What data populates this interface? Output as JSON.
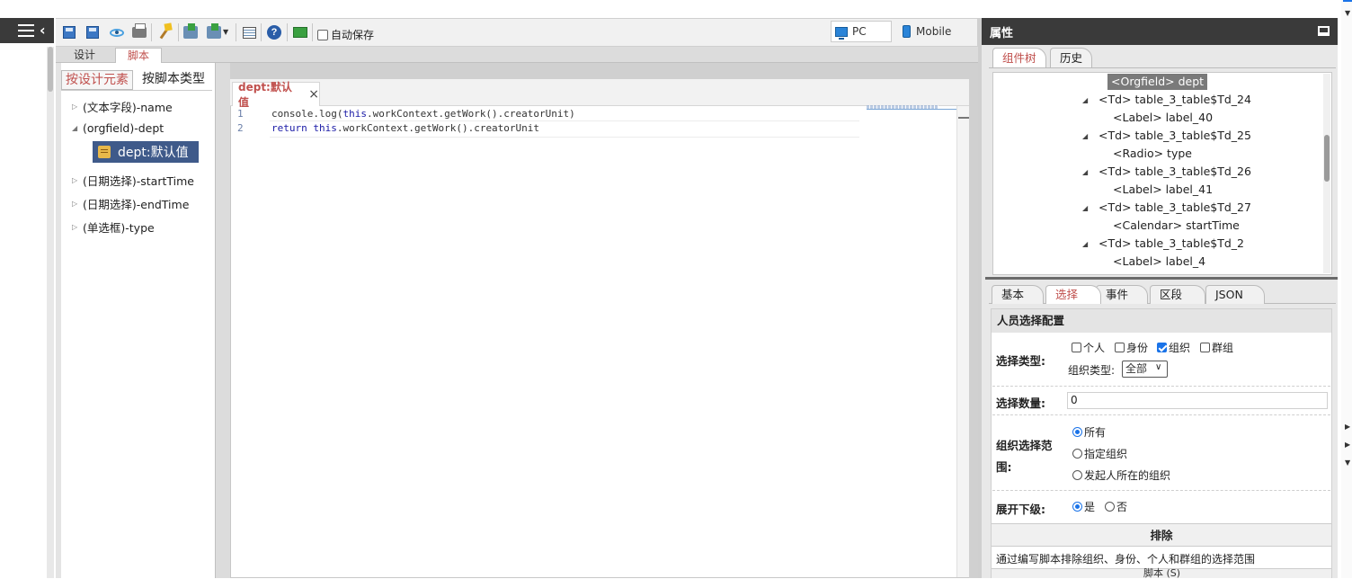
{
  "toolbar": {
    "autosave_label": "自动保存",
    "devices": [
      {
        "label": "PC"
      },
      {
        "label": "Mobile"
      }
    ]
  },
  "mode_tabs": [
    {
      "label": "设计"
    },
    {
      "label": "脚本"
    }
  ],
  "left_panel": {
    "tabs": [
      {
        "label": "按设计元素"
      },
      {
        "label": "按脚本类型"
      }
    ],
    "tree": [
      {
        "label": "(文本字段)-name",
        "expanded": false
      },
      {
        "label": "(orgfield)-dept",
        "expanded": true
      },
      {
        "label": "(日期选择)-startTime",
        "expanded": false
      },
      {
        "label": "(日期选择)-endTime",
        "expanded": false
      },
      {
        "label": "(单选框)-type",
        "expanded": false
      }
    ],
    "selected_script": "dept:默认值"
  },
  "editor": {
    "tab_label": "dept:默认值",
    "close_glyph": "×",
    "lines": [
      {
        "no": "1",
        "pre": "console.log(",
        "kw": "this",
        "post": ".workContext.getWork().creatorUnit)"
      },
      {
        "no": "2",
        "kw1": "return",
        "mid": " ",
        "kw2": "this",
        "post": ".workContext.getWork().creatorUnit"
      }
    ]
  },
  "properties": {
    "title": "属性",
    "tree_tabs": [
      {
        "label": "组件树"
      },
      {
        "label": "历史"
      }
    ],
    "component_tree": [
      {
        "label": "<Orgfield> dept",
        "selected": true
      },
      {
        "label": "<Td> table_3_table$Td_24",
        "arrow": true
      },
      {
        "label": "<Label> label_40"
      },
      {
        "label": "<Td> table_3_table$Td_25",
        "arrow": true
      },
      {
        "label": "<Radio> type"
      },
      {
        "label": "<Td> table_3_table$Td_26",
        "arrow": true
      },
      {
        "label": "<Label> label_41"
      },
      {
        "label": "<Td> table_3_table$Td_27",
        "arrow": true
      },
      {
        "label": "<Calendar> startTime"
      },
      {
        "label": "<Td> table_3_table$Td_2",
        "arrow": true
      },
      {
        "label": "<Label> label_4"
      }
    ],
    "prop_tabs": [
      {
        "label": "基本"
      },
      {
        "label": "选择"
      },
      {
        "label": "事件"
      },
      {
        "label": "区段"
      },
      {
        "label": "JSON"
      }
    ],
    "form": {
      "section_title": "人员选择配置",
      "select_type": {
        "label": "选择类型:",
        "options": [
          {
            "label": "个人",
            "checked": false
          },
          {
            "label": "身份",
            "checked": false
          },
          {
            "label": "组织",
            "checked": true
          },
          {
            "label": "群组",
            "checked": false
          }
        ],
        "org_type_label": "组织类型:",
        "org_type_value": "全部"
      },
      "select_count": {
        "label": "选择数量:",
        "value": "0"
      },
      "org_range": {
        "label_line1": "组织选择范",
        "label_line2": "围:",
        "options": [
          {
            "label": "所有",
            "checked": true
          },
          {
            "label": "指定组织",
            "checked": false
          },
          {
            "label": "发起人所在的组织",
            "checked": false
          }
        ]
      },
      "expand_sub": {
        "label": "展开下级:",
        "options": [
          {
            "label": "是",
            "checked": true
          },
          {
            "label": "否",
            "checked": false
          }
        ]
      },
      "exclude": {
        "title": "排除",
        "description": "通过编写脚本排除组织、身份、个人和群组的选择范围",
        "script_label": "脚本 (S)"
      }
    }
  }
}
